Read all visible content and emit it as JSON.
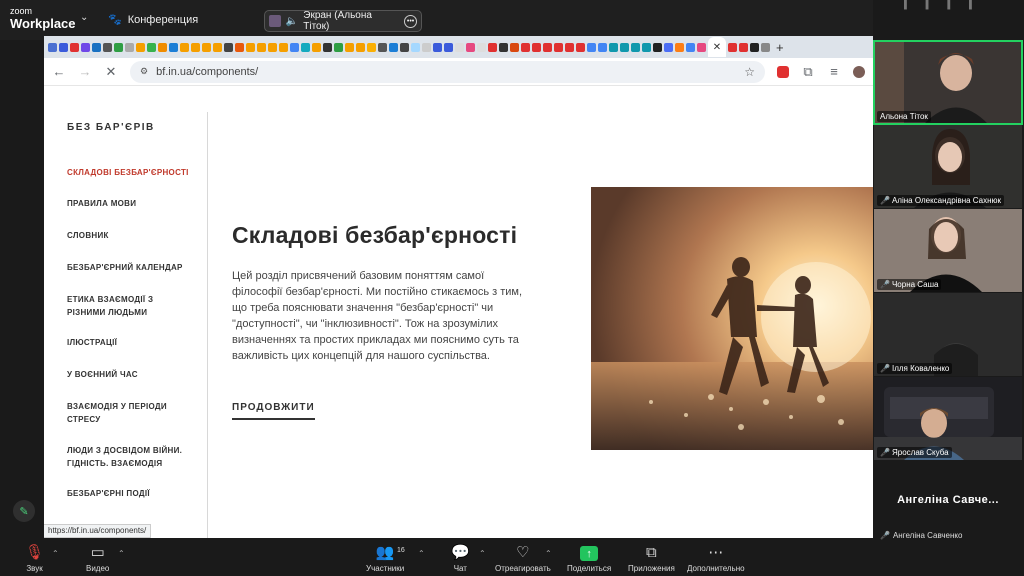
{
  "zoom": {
    "logo_small": "zoom",
    "logo_big": "Workplace",
    "meeting_title": "Конференция",
    "share_label": "Экран (Альона Тіток)"
  },
  "browser": {
    "url": "bf.in.ua/components/",
    "status_url": "https://bf.in.ua/components/"
  },
  "site": {
    "brand": "БЕЗ БАР'ЄРІВ",
    "menu": [
      "Складові безбар'єрності",
      "Правила мови",
      "Словник",
      "Безбар'єрний календар",
      "Етика взаємодії з різними людьми",
      "Ілюстрації",
      "У воєнний час",
      "Взаємодія у періоди стресу",
      "Люди з досвідом війни. Гідність. Взаємодія",
      "Безбар'єрні події"
    ],
    "active_index": 0,
    "heading": "Складові безбар'єрності",
    "description": "Цей розділ присвячений базовим поняттям самої філософії безбар'єрності. Ми постійно стикаємось з тим, що треба пояснювати значення \"безбар'єрності\" чи \"доступності\", чи \"інклюзивності\". Тож на зрозумілих визначеннях та простих прикладах ми пояснимо суть та важливість цих концепцій для нашого суспільства.",
    "cta": "ПРОДОВЖИТИ"
  },
  "participants": [
    {
      "name": "Альона Тіток",
      "muted": false,
      "speaking": true
    },
    {
      "name": "Аліна Олександрівна Сахнюк",
      "muted": true
    },
    {
      "name": "Чорна Саша",
      "muted": true
    },
    {
      "name": "Ілля Коваленко",
      "muted": true
    },
    {
      "name": "Ярослав Скуба",
      "muted": true
    }
  ],
  "no_video_participant": {
    "display": "Ангеліна Савче...",
    "name": "Ангеліна Савченко"
  },
  "toolbar": {
    "audio": "Звук",
    "video": "Видео",
    "participants": "Участники",
    "participants_count": "16",
    "chat": "Чат",
    "react": "Отреагировать",
    "share": "Поделиться",
    "apps": "Приложения",
    "more": "Дополнительно"
  }
}
